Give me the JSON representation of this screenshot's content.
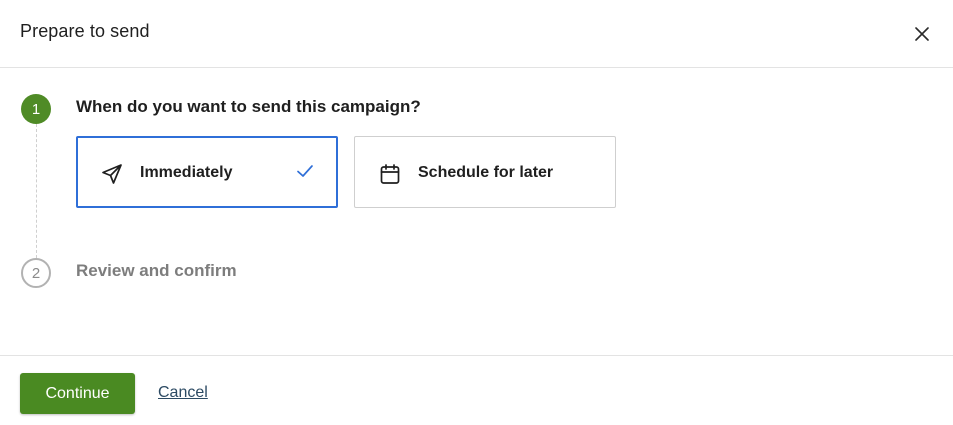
{
  "dialog": {
    "title": "Prepare to send",
    "close_icon": "close-icon"
  },
  "steps": [
    {
      "number": "1",
      "label": "When do you want to send this campaign?",
      "status": "active"
    },
    {
      "number": "2",
      "label": "Review and confirm",
      "status": "inactive"
    }
  ],
  "send_options": [
    {
      "label": "Immediately",
      "icon": "send-icon",
      "selected": true
    },
    {
      "label": "Schedule for later",
      "icon": "calendar-icon",
      "selected": false
    }
  ],
  "footer": {
    "continue_label": "Continue",
    "cancel_label": "Cancel"
  },
  "colors": {
    "accent_green": "#4a8a22",
    "selected_border": "#2f6fd8",
    "link": "#2c4a63"
  }
}
